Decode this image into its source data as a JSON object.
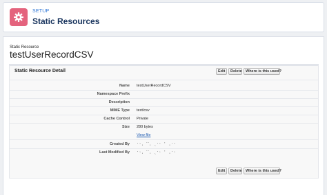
{
  "header": {
    "section": "SETUP",
    "title": "Static Resources",
    "icon": "gear-icon",
    "icon_color": "#e4637d"
  },
  "record": {
    "type_label": "Static Resource",
    "name": "testUserRecordCSV"
  },
  "detail": {
    "title": "Static Resource Detail",
    "buttons": {
      "edit": "Edit",
      "delete": "Delete",
      "where_used": "Where is this used?"
    },
    "rows": [
      {
        "label": "Name",
        "value": "testUserRecordCSV"
      },
      {
        "label": "Namespace Prefix",
        "value": ""
      },
      {
        "label": "Description",
        "value": ""
      },
      {
        "label": "MIME Type",
        "value": "text/csv"
      },
      {
        "label": "Cache Control",
        "value": "Private"
      },
      {
        "label": "Size",
        "value": "280 bytes"
      },
      {
        "label": "",
        "value": "View file"
      },
      {
        "label": "Created By",
        "value": "ˑ˒ˌ ˋˊˌ ˎˑ˒ ˈ ˌˑ˒"
      },
      {
        "label": "Last Modified By",
        "value": "ˑ˒ˌ ˋˊˌ ˎˑ˒ ˈ ˌˑ˒"
      }
    ]
  }
}
